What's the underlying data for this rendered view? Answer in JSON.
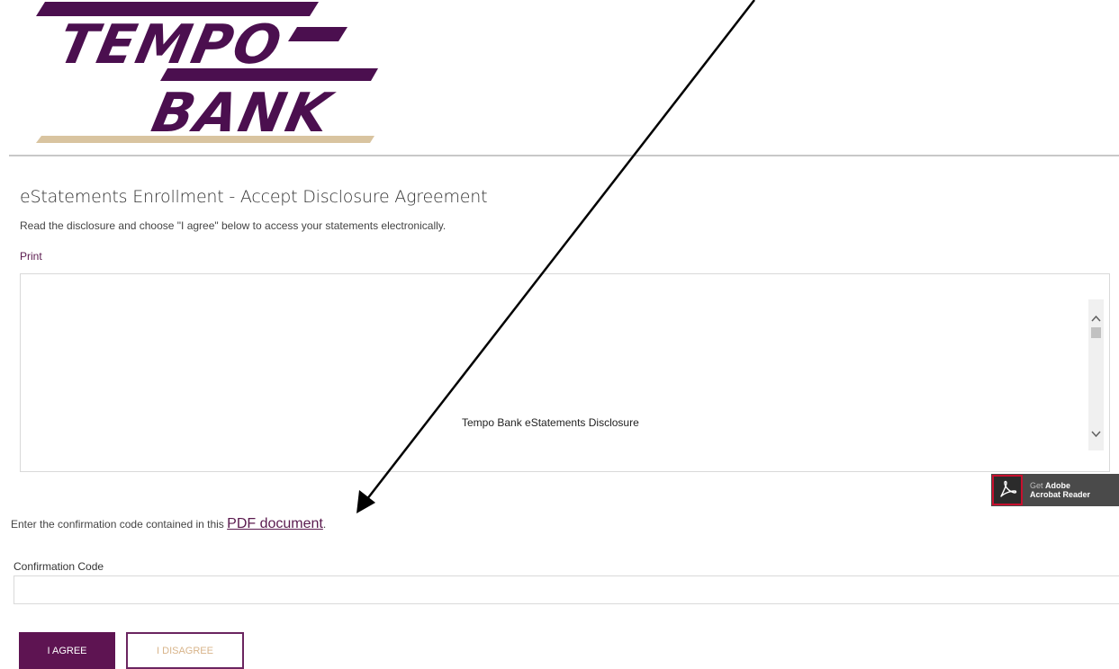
{
  "header": {
    "logo_line1": "TEMPO",
    "logo_line2": "BANK"
  },
  "page": {
    "title": "eStatements Enrollment - Accept Disclosure Agreement",
    "intro": "Read the disclosure and choose \"I agree\" below to access your statements electronically.",
    "print_link": "Print"
  },
  "disclosure": {
    "heading": "Tempo Bank eStatements Disclosure"
  },
  "acrobat_badge": {
    "get": "Get",
    "line1": "Adobe",
    "line2": "Acrobat Reader"
  },
  "confirmation": {
    "instruction_prefix": "Enter the confirmation code contained in this ",
    "pdf_link": "PDF document",
    "instruction_suffix": ".",
    "label": "Confirmation Code",
    "value": "",
    "placeholder": ""
  },
  "buttons": {
    "agree": "I AGREE",
    "disagree": "I DISAGREE"
  },
  "colors": {
    "brand_purple": "#5e1452",
    "logo_purple": "#4b0f4f",
    "logo_tan": "#d9c4a0",
    "link_purple": "#5a1a4e",
    "disagree_text": "#d8b48a",
    "acrobat_red": "#c8102e"
  },
  "icons": {
    "scroll_up": "chevron-up-icon",
    "scroll_down": "chevron-down-icon",
    "acrobat": "acrobat-reader-icon"
  }
}
